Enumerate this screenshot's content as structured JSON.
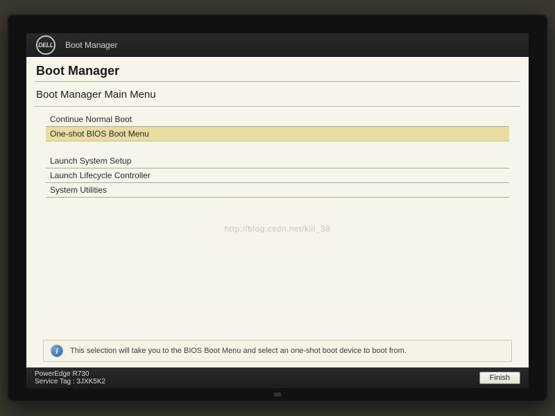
{
  "logo_text": "DELL",
  "titlebar": {
    "title": "Boot Manager"
  },
  "header": "Boot Manager",
  "sub_header": "Boot Manager Main Menu",
  "menu": {
    "group1": [
      {
        "label": "Continue Normal Boot",
        "selected": false
      },
      {
        "label": "One-shot BIOS Boot Menu",
        "selected": true
      }
    ],
    "group2": [
      {
        "label": "Launch System Setup",
        "selected": false
      },
      {
        "label": "Launch Lifecycle Controller",
        "selected": false
      },
      {
        "label": "System Utilities",
        "selected": false
      }
    ]
  },
  "watermark": "http://blog.csdn.net/kill_38",
  "help_text": "This selection will take you to the BIOS Boot Menu and select an one-shot boot device to boot from.",
  "footer": {
    "model": "PowerEdge R730",
    "service_tag_label": "Service Tag : 3JXK5K2",
    "finish_label": "Finish"
  }
}
